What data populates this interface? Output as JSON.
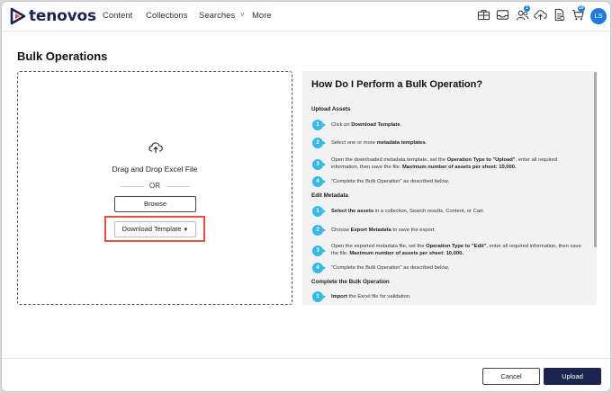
{
  "app": {
    "brand": "tenovos",
    "accent": "#1b2550",
    "link_blue": "#1f7ae0",
    "step_color": "#37b9e6"
  },
  "nav": {
    "items": [
      {
        "label": "Content"
      },
      {
        "label": "Collections"
      },
      {
        "label": "Searches"
      },
      {
        "label": "More"
      }
    ]
  },
  "toolbar": {
    "icons": [
      "briefcase-icon",
      "inbox-icon",
      "users-icon",
      "cloud-upload-icon",
      "document-icon",
      "cart-icon"
    ],
    "users_badge": "1",
    "cart_badge": "10",
    "avatar_initials": "LS"
  },
  "page": {
    "title": "Bulk Operations"
  },
  "dropzone": {
    "drop_text": "Drag and Drop Excel File",
    "or_text": "OR",
    "browse_label": "Browse",
    "download_label": "Download Template"
  },
  "help": {
    "title": "How Do I Perform a Bulk Operation?",
    "sections": [
      {
        "heading": "Upload Assets",
        "steps": [
          {
            "num": "1",
            "pre": "Click on ",
            "bold": "Download Template",
            "post": "."
          },
          {
            "num": "2",
            "pre": "Select one or more ",
            "bold": "metadata templates",
            "post": "."
          },
          {
            "num": "3",
            "pre": "Open the downloaded metadata template, set the ",
            "bold": "Operation Type to \"Upload\"",
            "post": ", enter all required information, then save the file. ",
            "bold2": "Maximum number of assets per sheet: 10,000."
          },
          {
            "num": "4",
            "pre": "\"Complete the Bulk Operation\" as described below.",
            "bold": "",
            "post": ""
          }
        ]
      },
      {
        "heading": "Edit Metadata",
        "steps": [
          {
            "num": "1",
            "pre": "",
            "bold": "Select the assets",
            "post": " in a collection, Search results, Content, or Cart."
          },
          {
            "num": "2",
            "pre": "Choose ",
            "bold": "Export Metadata",
            "post": " to save the export."
          },
          {
            "num": "3",
            "pre": "Open the exported metadata file, set the ",
            "bold": "Operation Type to \"Edit\"",
            "post": ", enter all required information, then save the file. ",
            "bold2": "Maximum number of assets per sheet: 10,000."
          },
          {
            "num": "4",
            "pre": "\"Complete the Bulk Operation\" as described below.",
            "bold": "",
            "post": ""
          }
        ]
      },
      {
        "heading": "Complete the Bulk Operation",
        "steps": [
          {
            "num": "1",
            "pre": "",
            "bold": "Import",
            "post": " the Excel file for validation."
          }
        ]
      }
    ]
  },
  "footer": {
    "cancel_label": "Cancel",
    "upload_label": "Upload"
  }
}
